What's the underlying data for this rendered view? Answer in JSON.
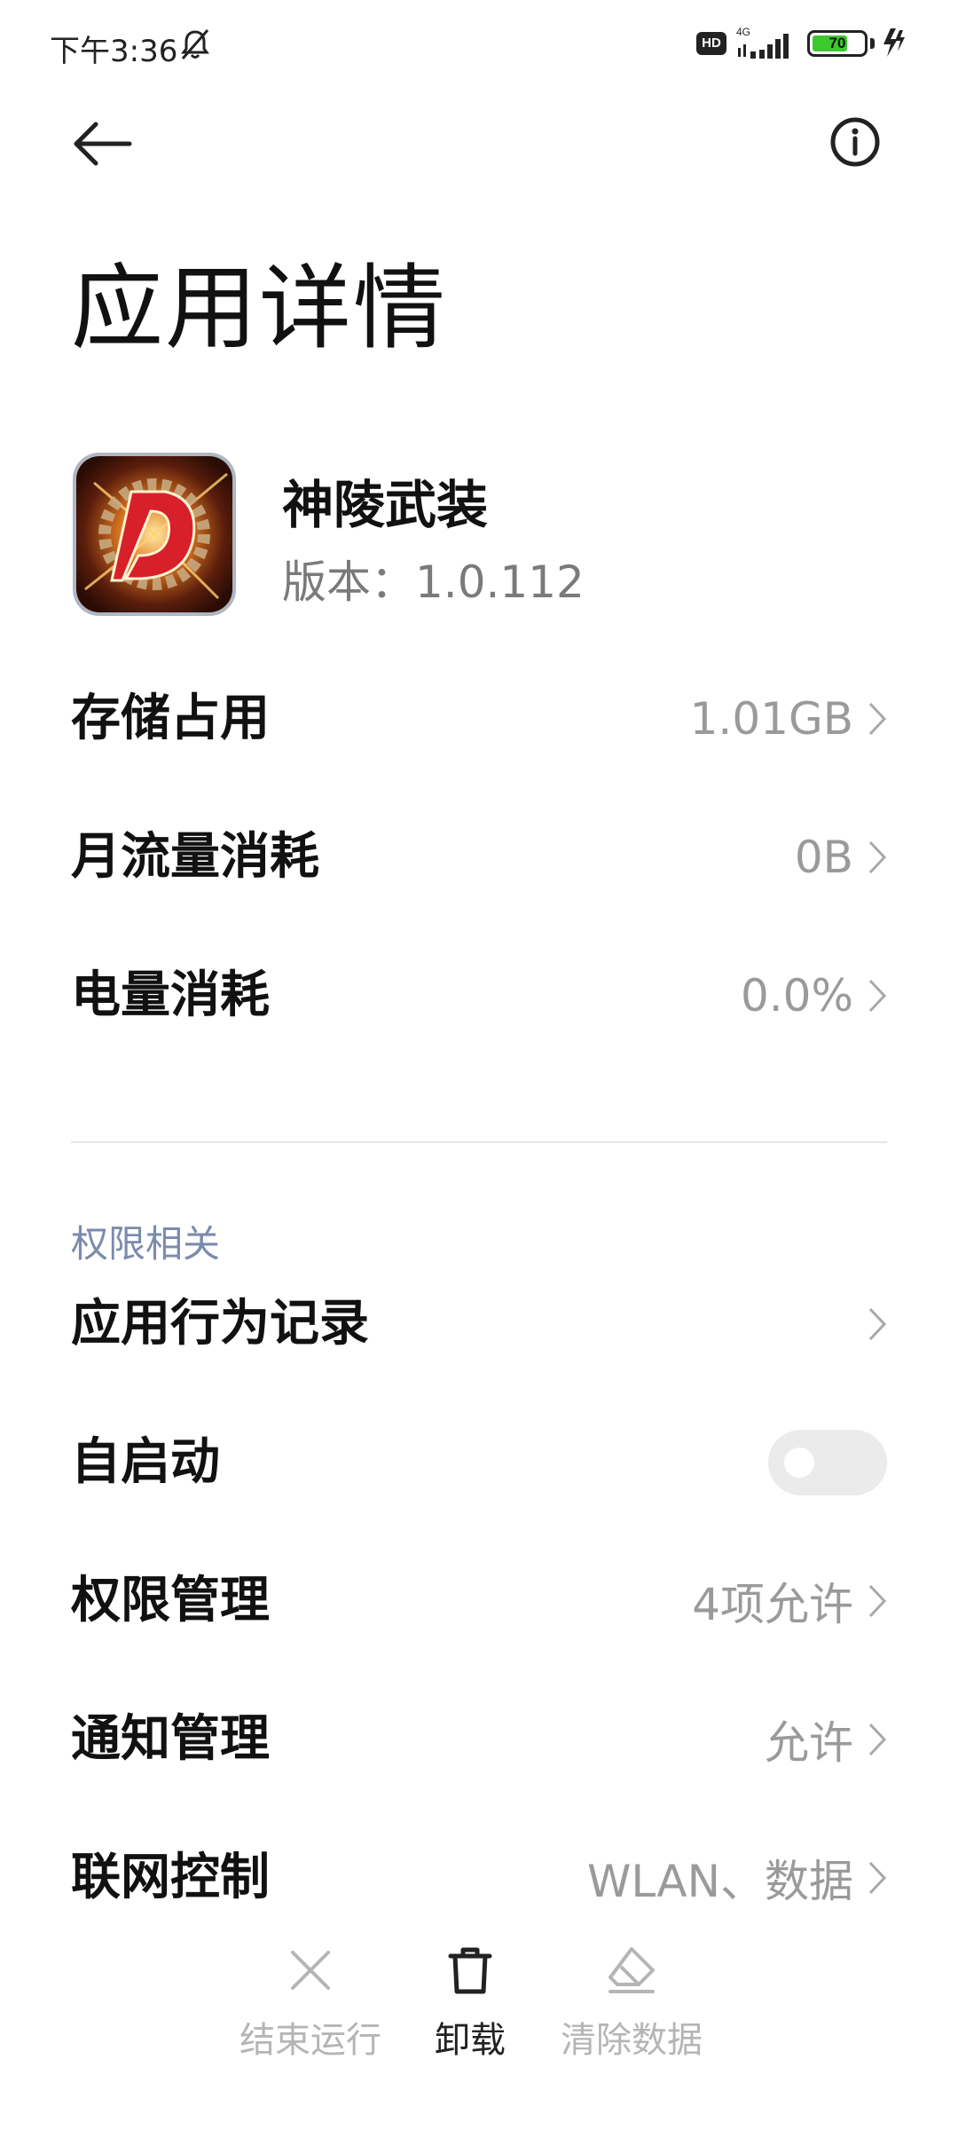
{
  "status_bar": {
    "time": "下午3:36",
    "network": "4G",
    "battery_level": "70",
    "battery_fraction": 0.7,
    "hd_label": "HD",
    "icons": [
      "bell-muted-icon",
      "hd-icon",
      "signal-icon",
      "battery-icon",
      "charging-icon"
    ]
  },
  "header": {
    "title": "应用详情",
    "back_icon": "arrow-left-icon",
    "info_icon": "info-icon"
  },
  "app": {
    "name": "神陵武装",
    "version": "版本：1.0.112",
    "icon": "app-icon"
  },
  "usage_rows": [
    {
      "label": "存储占用",
      "value": "1.01GB"
    },
    {
      "label": "月流量消耗",
      "value": "0B"
    },
    {
      "label": "电量消耗",
      "value": "0.0%"
    }
  ],
  "permissions_section": {
    "title": "权限相关",
    "rows": [
      {
        "label": "应用行为记录",
        "value": ""
      },
      {
        "label": "自启动",
        "toggle_on": false
      },
      {
        "label": "权限管理",
        "value": "4项允许"
      },
      {
        "label": "通知管理",
        "value": "允许"
      },
      {
        "label": "联网控制",
        "value": "WLAN、数据"
      }
    ]
  },
  "bottom_bar": {
    "items": [
      {
        "label": "结束运行",
        "icon": "close-icon",
        "enabled": false
      },
      {
        "label": "卸载",
        "icon": "trash-icon",
        "enabled": true
      },
      {
        "label": "清除数据",
        "icon": "eraser-icon",
        "enabled": false
      }
    ]
  },
  "colors": {
    "accent_section": "#7b8bad",
    "value_gray": "#9a9a9a",
    "battery_green": "#3ec72f"
  }
}
